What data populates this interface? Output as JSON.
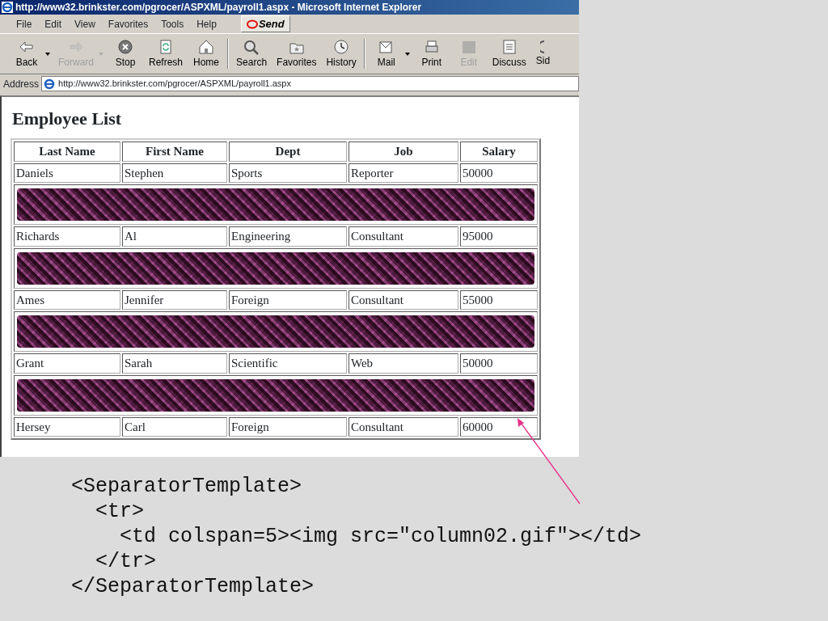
{
  "window": {
    "title": "http://www32.brinkster.com/pgrocer/ASPXML/payroll1.aspx - Microsoft Internet Explorer"
  },
  "menu": [
    "File",
    "Edit",
    "View",
    "Favorites",
    "Tools",
    "Help"
  ],
  "send_button": {
    "label": "Send"
  },
  "toolbar": [
    {
      "label": "Back",
      "kind": "back",
      "disabled": false,
      "dropdown": true,
      "group_end": false
    },
    {
      "label": "Forward",
      "kind": "forward",
      "disabled": true,
      "dropdown": true,
      "group_end": false
    },
    {
      "label": "Stop",
      "kind": "stop",
      "disabled": false,
      "dropdown": false,
      "group_end": false
    },
    {
      "label": "Refresh",
      "kind": "refresh",
      "disabled": false,
      "dropdown": false,
      "group_end": false
    },
    {
      "label": "Home",
      "kind": "home",
      "disabled": false,
      "dropdown": false,
      "group_end": true
    },
    {
      "label": "Search",
      "kind": "search",
      "disabled": false,
      "dropdown": false,
      "group_end": false
    },
    {
      "label": "Favorites",
      "kind": "favorites",
      "disabled": false,
      "dropdown": false,
      "group_end": false
    },
    {
      "label": "History",
      "kind": "history",
      "disabled": false,
      "dropdown": false,
      "group_end": true
    },
    {
      "label": "Mail",
      "kind": "mail",
      "disabled": false,
      "dropdown": true,
      "group_end": false
    },
    {
      "label": "Print",
      "kind": "print",
      "disabled": false,
      "dropdown": false,
      "group_end": false
    },
    {
      "label": "Edit",
      "kind": "edit",
      "disabled": true,
      "dropdown": false,
      "group_end": false
    },
    {
      "label": "Discuss",
      "kind": "discuss",
      "disabled": false,
      "dropdown": false,
      "group_end": false
    },
    {
      "label": "Sid",
      "kind": "cut",
      "disabled": false,
      "dropdown": false,
      "group_end": false
    }
  ],
  "address": {
    "label": "Address",
    "value": "http://www32.brinkster.com/pgrocer/ASPXML/payroll1.aspx"
  },
  "page": {
    "heading": "Employee List",
    "table": {
      "columns": [
        "Last Name",
        "First Name",
        "Dept",
        "Job",
        "Salary"
      ],
      "rows": [
        {
          "kind": "data",
          "cells": [
            "Daniels",
            "Stephen",
            "Sports",
            "Reporter",
            "50000"
          ]
        },
        {
          "kind": "separator"
        },
        {
          "kind": "data",
          "cells": [
            "Richards",
            "Al",
            "Engineering",
            "Consultant",
            "95000"
          ]
        },
        {
          "kind": "separator"
        },
        {
          "kind": "data",
          "cells": [
            "Ames",
            "Jennifer",
            "Foreign",
            "Consultant",
            "55000"
          ]
        },
        {
          "kind": "separator"
        },
        {
          "kind": "data",
          "cells": [
            "Grant",
            "Sarah",
            "Scientific",
            "Web",
            "50000"
          ]
        },
        {
          "kind": "separator"
        },
        {
          "kind": "data",
          "cells": [
            "Hersey",
            "Carl",
            "Foreign",
            "Consultant",
            "60000"
          ]
        }
      ]
    }
  },
  "code": [
    {
      "text": "<SeparatorTemplate>",
      "children": [
        {
          "text": "<tr>",
          "children": [
            {
              "text": "<td colspan=5><img src=\"column02.gif\"></td>"
            }
          ]
        },
        {
          "text": "</tr>"
        }
      ]
    },
    {
      "text": "</SeparatorTemplate>"
    }
  ]
}
